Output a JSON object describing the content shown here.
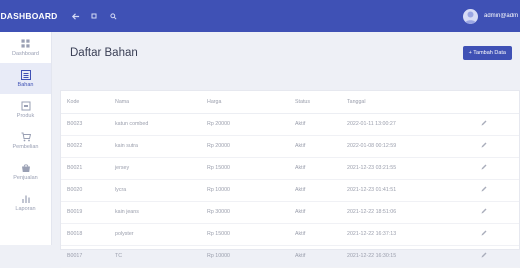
{
  "topbar": {
    "brand": "DASHBOARD",
    "icons": [
      "arrow-left-icon",
      "square-icon",
      "search-icon"
    ],
    "user_email": "admin@admin.co"
  },
  "sidebar": {
    "items": [
      {
        "label": "Dashboard",
        "icon": "grid-icon",
        "active": false
      },
      {
        "label": "Bahan",
        "icon": "list-icon",
        "active": true
      },
      {
        "label": "Produk",
        "icon": "box-icon",
        "active": false
      },
      {
        "label": "Pembelian",
        "icon": "cart-icon",
        "active": false
      },
      {
        "label": "Penjualan",
        "icon": "bag-icon",
        "active": false
      },
      {
        "label": "Laporan",
        "icon": "chart-icon",
        "active": false
      }
    ]
  },
  "main": {
    "title": "Daftar Bahan",
    "add_button": "+ Tambah Data",
    "table": {
      "headers": [
        "Kode",
        "Nama",
        "Harga",
        "Status",
        "Tanggal",
        ""
      ],
      "rows": [
        {
          "kode": "B0023",
          "nama": "katun combed",
          "harga": "Rp 20000",
          "status": "Aktif",
          "tanggal": "2022-01-11 13:00:27"
        },
        {
          "kode": "B0022",
          "nama": "kain sutra",
          "harga": "Rp 20000",
          "status": "Aktif",
          "tanggal": "2022-01-08 00:12:59"
        },
        {
          "kode": "B0021",
          "nama": "jersey",
          "harga": "Rp 15000",
          "status": "Aktif",
          "tanggal": "2021-12-23 03:21:55"
        },
        {
          "kode": "B0020",
          "nama": "lycra",
          "harga": "Rp 10000",
          "status": "Aktif",
          "tanggal": "2021-12-23 01:41:51"
        },
        {
          "kode": "B0019",
          "nama": "kain jeans",
          "harga": "Rp 30000",
          "status": "Aktif",
          "tanggal": "2021-12-22 18:51:06"
        },
        {
          "kode": "B0018",
          "nama": "polyster",
          "harga": "Rp 15000",
          "status": "Aktif",
          "tanggal": "2021-12-22 16:37:13"
        },
        {
          "kode": "B0017",
          "nama": "TC",
          "harga": "Rp 10000",
          "status": "Aktif",
          "tanggal": "2021-12-22 16:30:15"
        }
      ]
    }
  },
  "colors": {
    "primary": "#3f51b5",
    "background": "#eef0f6"
  }
}
